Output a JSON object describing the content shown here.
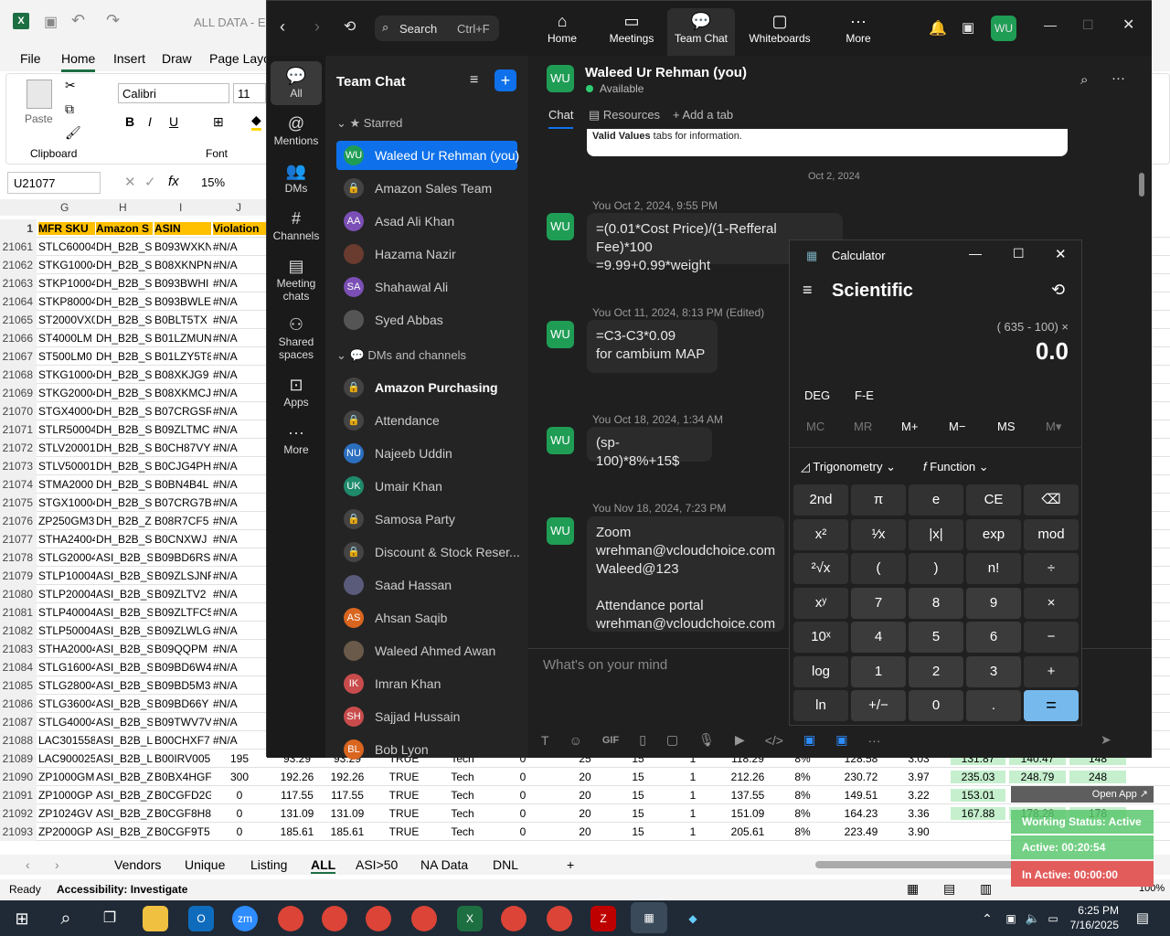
{
  "excel": {
    "title": "ALL DATA - Ex",
    "menu": [
      "File",
      "Home",
      "Insert",
      "Draw",
      "Page Layo"
    ],
    "font_name": "Calibri",
    "font_size": "11",
    "clipboard_label": "Clipboard",
    "font_group_label": "Font",
    "paste_label": "Paste",
    "name_box": "U21077",
    "formula_value": "15%",
    "col_headers": [
      "G",
      "H",
      "I",
      "J"
    ],
    "header_row": [
      "MFR SKU",
      "Amazon S",
      "ASIN",
      "Violation"
    ],
    "rows": [
      [
        "21061",
        "STLC60004",
        "DH_B2B_S",
        "B093WXKN",
        "#N/A"
      ],
      [
        "21062",
        "STKG10004",
        "DH_B2B_S",
        "B08XKNPN",
        "#N/A"
      ],
      [
        "21063",
        "STKP10004",
        "DH_B2B_S",
        "B093BWHI",
        "#N/A"
      ],
      [
        "21064",
        "STKP80004",
        "DH_B2B_S",
        "B093BWLE",
        "#N/A"
      ],
      [
        "21065",
        "ST2000VX0",
        "DH_B2B_S",
        "B0BLT5TX",
        "#N/A"
      ],
      [
        "21066",
        "ST4000LM",
        "DH_B2B_S",
        "B01LZMUN",
        "#N/A"
      ],
      [
        "21067",
        "ST500LM0",
        "DH_B2B_S",
        "B01LZY5T8",
        "#N/A"
      ],
      [
        "21068",
        "STKG10004",
        "DH_B2B_S",
        "B08XKJG9",
        "#N/A"
      ],
      [
        "21069",
        "STKG20004",
        "DH_B2B_S",
        "B08XKMCJ",
        "#N/A"
      ],
      [
        "21070",
        "STGX40004",
        "DH_B2B_S",
        "B07CRGSR",
        "#N/A"
      ],
      [
        "21071",
        "STLR50004",
        "DH_B2B_S",
        "B09ZLTMC",
        "#N/A"
      ],
      [
        "21072",
        "STLV20001",
        "DH_B2B_S",
        "B0CH87VY",
        "#N/A"
      ],
      [
        "21073",
        "STLV50001",
        "DH_B2B_S",
        "B0CJG4PH",
        "#N/A"
      ],
      [
        "21074",
        "STMA2000",
        "DH_B2B_S",
        "B0BN4B4L",
        "#N/A"
      ],
      [
        "21075",
        "STGX10004",
        "DH_B2B_S",
        "B07CRG7B",
        "#N/A"
      ],
      [
        "21076",
        "ZP250GM3",
        "DH_B2B_Z",
        "B08R7CF5",
        "#N/A"
      ],
      [
        "21077",
        "STHA24004",
        "DH_B2B_S",
        "B0CNXWJ",
        "#N/A"
      ],
      [
        "21078",
        "STLG20004",
        "ASI_B2B_S",
        "B09BD6RS",
        "#N/A"
      ],
      [
        "21079",
        "STLP10004",
        "ASI_B2B_S",
        "B09ZLSJNF",
        "#N/A"
      ],
      [
        "21080",
        "STLP20004",
        "ASI_B2B_S",
        "B09ZLTV2",
        "#N/A"
      ],
      [
        "21081",
        "STLP40004",
        "ASI_B2B_S",
        "B09ZLTFC5",
        "#N/A"
      ],
      [
        "21082",
        "STLP50004",
        "ASI_B2B_S",
        "B09ZLWLG",
        "#N/A"
      ],
      [
        "21083",
        "STHA20004",
        "ASI_B2B_S",
        "B09QQPM",
        "#N/A"
      ],
      [
        "21084",
        "STLG16004",
        "ASI_B2B_S",
        "B09BD6W4",
        "#N/A"
      ],
      [
        "21085",
        "STLG28004",
        "ASI_B2B_S",
        "B09BD5M3",
        "#N/A"
      ],
      [
        "21086",
        "STLG36004",
        "ASI_B2B_S",
        "B09BD66Y",
        "#N/A"
      ],
      [
        "21087",
        "STLG40004",
        "ASI_B2B_S",
        "B09TWV7V",
        "#N/A"
      ],
      [
        "21088",
        "LAC301558",
        "ASI_B2B_L",
        "B00CHXF7",
        "#N/A"
      ]
    ],
    "full_rows": [
      [
        "21089",
        "LAC900025",
        "ASI_B2B_L",
        "B00IRV005",
        "195",
        "93.29",
        "93.29",
        "TRUE",
        "Tech",
        "0",
        "25",
        "15",
        "1",
        "118.29",
        "8%",
        "128.58",
        "3.03",
        "131.87",
        "140.47",
        "148"
      ],
      [
        "21090",
        "ZP1000GM",
        "ASI_B2B_Z",
        "B0BX4HGF",
        "300",
        "192.26",
        "192.26",
        "TRUE",
        "Tech",
        "0",
        "20",
        "15",
        "1",
        "212.26",
        "8%",
        "230.72",
        "3.97",
        "235.03",
        "248.79",
        "248"
      ],
      [
        "21091",
        "ZP1000GP",
        "ASI_B2B_Z",
        "B0CGFD2G",
        "0",
        "117.55",
        "117.55",
        "TRUE",
        "Tech",
        "0",
        "20",
        "15",
        "1",
        "137.55",
        "8%",
        "149.51",
        "3.22",
        "153.01",
        "",
        ""
      ],
      [
        "21092",
        "ZP1024GV",
        "ASI_B2B_Z",
        "B0CGF8H8",
        "0",
        "131.09",
        "131.09",
        "TRUE",
        "Tech",
        "0",
        "20",
        "15",
        "1",
        "151.09",
        "8%",
        "164.23",
        "3.36",
        "167.88",
        "178.28",
        "178"
      ],
      [
        "21093",
        "ZP2000GP",
        "ASI_B2B_Z",
        "B0CGF9T5",
        "0",
        "185.61",
        "185.61",
        "TRUE",
        "Tech",
        "0",
        "20",
        "15",
        "1",
        "205.61",
        "8%",
        "223.49",
        "3.90",
        "",
        "",
        ""
      ]
    ],
    "sheet_tabs": [
      "Vendors",
      "Unique",
      "Listing",
      "ALL",
      "ASI>50",
      "NA Data",
      "DNL"
    ],
    "status_ready": "Ready",
    "accessibility": "Accessibility: Investigate",
    "zoom_pct": "100%"
  },
  "zoom": {
    "search_label": "Search",
    "search_shortcut": "Ctrl+F",
    "nav": [
      "Home",
      "Meetings",
      "Team Chat",
      "Whiteboards",
      "More"
    ],
    "profile_initials": "WU",
    "rail": [
      "All",
      "Mentions",
      "DMs",
      "Channels",
      "Meeting chats",
      "Shared spaces",
      "Apps",
      "More"
    ],
    "side_title": "Team Chat",
    "starred_label": "Starred",
    "dms_label": "DMs and channels",
    "starred": [
      {
        "name": "Waleed Ur Rehman (you)",
        "initials": "WU",
        "color": "#1f9d55"
      },
      {
        "name": "Amazon Sales Team",
        "initials": "",
        "color": "#444"
      },
      {
        "name": "Asad Ali Khan",
        "initials": "AA",
        "color": "#7b4fb5"
      },
      {
        "name": "Hazama Nazir",
        "initials": "",
        "color": "#6a3b2f"
      },
      {
        "name": "Shahawal Ali",
        "initials": "SA",
        "color": "#7b4fb5"
      },
      {
        "name": "Syed Abbas",
        "initials": "",
        "color": "#555"
      }
    ],
    "dms": [
      {
        "name": "Amazon Purchasing",
        "initials": "",
        "color": "#444"
      },
      {
        "name": "Attendance",
        "initials": "",
        "color": "#444"
      },
      {
        "name": "Najeeb Uddin",
        "initials": "NU",
        "color": "#2c6fbf"
      },
      {
        "name": "Umair Khan",
        "initials": "UK",
        "color": "#1f8a6a"
      },
      {
        "name": "Samosa Party",
        "initials": "",
        "color": "#444"
      },
      {
        "name": "Discount & Stock Reser...",
        "initials": "",
        "color": "#444"
      },
      {
        "name": "Saad Hassan",
        "initials": "",
        "color": "#5a5a7a"
      },
      {
        "name": "Ahsan Saqib",
        "initials": "AS",
        "color": "#d9651f"
      },
      {
        "name": "Waleed Ahmed Awan",
        "initials": "",
        "color": "#6a5a4a"
      },
      {
        "name": "Imran Khan",
        "initials": "IK",
        "color": "#c94c4c"
      },
      {
        "name": "Sajjad Hussain",
        "initials": "SH",
        "color": "#c94c4c"
      },
      {
        "name": "Bob Lyon",
        "initials": "BL",
        "color": "#d9651f"
      }
    ],
    "chat_name": "Waleed Ur Rehman (you)",
    "chat_status": "Available",
    "chat_tabs": [
      "Chat",
      "Resources",
      "Add a tab"
    ],
    "top_snippet_bold": "Valid Values",
    "top_snippet_rest": " tabs for information.",
    "date_divider": "Oct 2, 2024",
    "messages": [
      {
        "meta": "You Oct 2, 2024, 9:55 PM",
        "text": "=(0.01*Cost Price)/(1-Refferal Fee)*100\n=9.99+0.99*weight"
      },
      {
        "meta": "You Oct 11, 2024, 8:13 PM (Edited)",
        "text": "=C3-C3*0.09\nfor cambium MAP"
      },
      {
        "meta": "You Oct 18, 2024, 1:34 AM",
        "text": "(sp-100)*8%+15$"
      },
      {
        "meta": "You Nov 18, 2024, 7:23 PM",
        "text": "Zoom\nwrehman@vcloudchoice.com\nWaleed@123\n\nAttendance portal\nwrehman@vcloudchoice.com"
      }
    ],
    "composer_placeholder": "What's on your mind"
  },
  "calculator": {
    "title": "Calculator",
    "mode": "Scientific",
    "expression": "( 635 - 100) ×",
    "display": "0.0",
    "deg": "DEG",
    "fe": "F-E",
    "memory": [
      "MC",
      "MR",
      "M+",
      "M−",
      "MS",
      "M▾"
    ],
    "trig_label": "Trigonometry",
    "func_label": "Function",
    "keys": [
      [
        "2nd",
        "π",
        "e",
        "CE",
        "⌫"
      ],
      [
        "x²",
        "¹⁄x",
        "|x|",
        "exp",
        "mod"
      ],
      [
        "²√x",
        "(",
        ")",
        "n!",
        "÷"
      ],
      [
        "xʸ",
        "7",
        "8",
        "9",
        "×"
      ],
      [
        "10ˣ",
        "4",
        "5",
        "6",
        "−"
      ],
      [
        "log",
        "1",
        "2",
        "3",
        "+"
      ],
      [
        "ln",
        "+/−",
        "0",
        ".",
        "="
      ]
    ]
  },
  "widget": {
    "open_app": "Open App ↗",
    "working_status": "Working Status: Active",
    "active": "Active: 00:20:54",
    "inactive": "In Active: 00:00:00"
  },
  "taskbar": {
    "time": "6:25 PM",
    "date": "7/16/2025"
  }
}
